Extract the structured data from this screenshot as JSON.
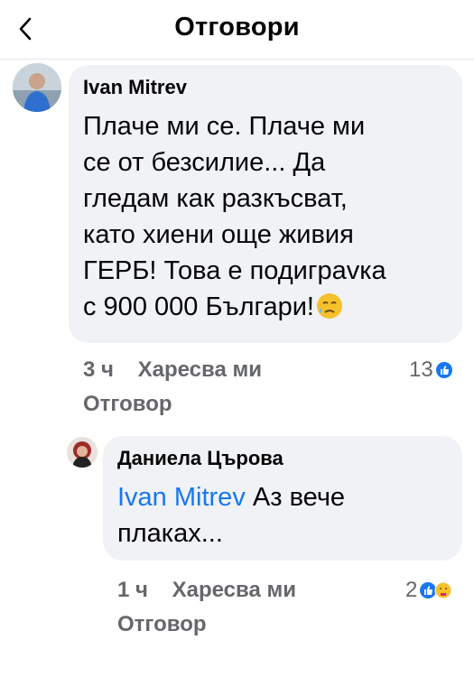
{
  "header": {
    "title": "Отговори",
    "back_icon": "chevron-left-icon"
  },
  "comment": {
    "author": "Ivan Mitrev",
    "lines": [
      "Плаче ми се. Плаче ми",
      "се от безсилие... Да",
      "гледам как разкъсват,",
      "като хиени още живия",
      "ГЕРБ! Това е подиграvка",
      "с 900 000 Българи!"
    ],
    "emoji": "sad-relieved-face-icon",
    "time": "3 ч",
    "like_label": "Харесва ми",
    "reply_label": "Отговор",
    "reaction_count": "13",
    "reaction_icons": [
      "like-icon"
    ]
  },
  "reply": {
    "author": "Даниела Църова",
    "mention": "Ivan Mitrev",
    "text_line1": " Аз вече",
    "text_line2": "плаках...",
    "time": "1 ч",
    "like_label": "Харесва ми",
    "reply_label": "Отговор",
    "reaction_count": "2",
    "reaction_icons": [
      "like-icon",
      "care-icon"
    ]
  },
  "colors": {
    "accent": "#1877f2",
    "bubble": "#f0f2f5",
    "meta": "#65676b"
  }
}
